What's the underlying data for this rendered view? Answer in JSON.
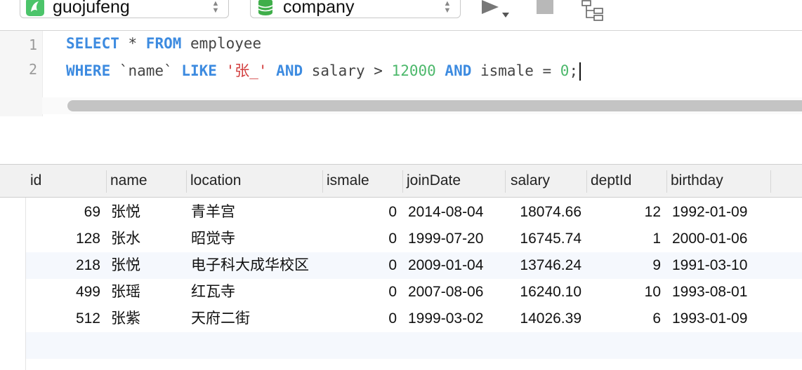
{
  "toolbar": {
    "connection": "guojufeng",
    "database": "company"
  },
  "editor": {
    "line_numbers": [
      "1",
      "2"
    ],
    "line1": {
      "kw_select": "SELECT",
      "star": " * ",
      "kw_from": "FROM",
      "table": " employee"
    },
    "line2": {
      "kw_where": "WHERE",
      "t1": " `name` ",
      "kw_like": "LIKE",
      "str": " '张_' ",
      "kw_and1": "AND",
      "t2": " salary > ",
      "num1": "12000",
      "t3": " ",
      "kw_and2": "AND",
      "t4": " ismale = ",
      "num2": "0",
      "t5": ";"
    }
  },
  "grid": {
    "columns": [
      "id",
      "name",
      "location",
      "ismale",
      "joinDate",
      "salary",
      "deptId",
      "birthday"
    ],
    "rows": [
      [
        "69",
        "张悦",
        "青羊宫",
        "0",
        "2014-08-04",
        "18074.66",
        "12",
        "1992-01-09"
      ],
      [
        "128",
        "张水",
        "昭觉寺",
        "0",
        "1999-07-20",
        "16745.74",
        "1",
        "2000-01-06"
      ],
      [
        "218",
        "张悦",
        "电子科大成华校区",
        "0",
        "2009-01-04",
        "13746.24",
        "9",
        "1991-03-10"
      ],
      [
        "499",
        "张瑶",
        "红瓦寺",
        "0",
        "2007-08-06",
        "16240.10",
        "10",
        "1993-08-01"
      ],
      [
        "512",
        "张紫",
        "天府二街",
        "0",
        "1999-03-02",
        "14026.39",
        "6",
        "1993-01-09"
      ]
    ]
  },
  "colors": {
    "keyword": "#3d8be0",
    "string": "#d23d3d",
    "number": "#4cb86b",
    "connection_icon": "#4cc46a",
    "database_icon": "#3fae4a"
  },
  "icons": {
    "connection": "dolphin-connection-icon",
    "database": "database-cylinder-icon",
    "run": "run-play-icon",
    "stop": "stop-square-icon",
    "explain": "explain-tree-icon"
  }
}
